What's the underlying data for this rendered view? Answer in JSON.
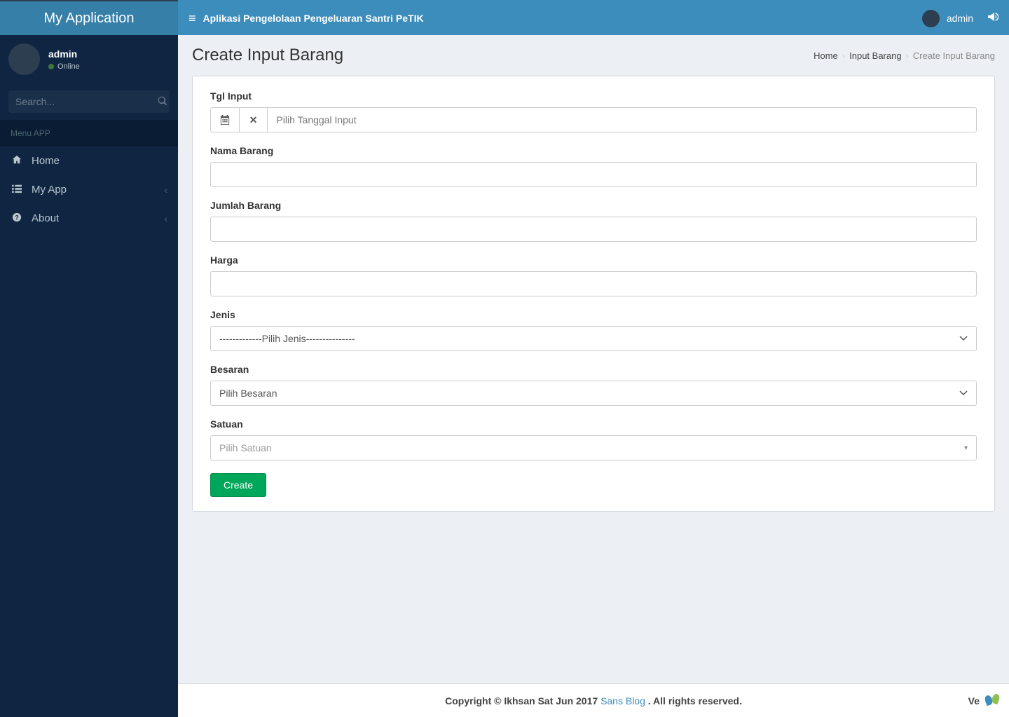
{
  "header": {
    "logo": "My Application",
    "app_title": "Aplikasi Pengelolaan Pengeluaran Santri PeTIK",
    "user_name": "admin"
  },
  "sidebar": {
    "user": {
      "name": "admin",
      "status": "Online"
    },
    "search_placeholder": "Search...",
    "menu_header": "Menu APP",
    "items": [
      {
        "label": "Home",
        "icon": "home-icon",
        "has_children": false
      },
      {
        "label": "My App",
        "icon": "list-icon",
        "has_children": true
      },
      {
        "label": "About",
        "icon": "question-icon",
        "has_children": true
      }
    ]
  },
  "page": {
    "title": "Create Input Barang",
    "breadcrumb": [
      {
        "label": "Home"
      },
      {
        "label": "Input Barang"
      },
      {
        "label": "Create Input Barang"
      }
    ]
  },
  "form": {
    "tgl_input": {
      "label": "Tgl Input",
      "placeholder": "Pilih Tanggal Input"
    },
    "nama_barang": {
      "label": "Nama Barang"
    },
    "jumlah_barang": {
      "label": "Jumlah Barang"
    },
    "harga": {
      "label": "Harga"
    },
    "jenis": {
      "label": "Jenis",
      "placeholder": "-------------Pilih Jenis---------------"
    },
    "besaran": {
      "label": "Besaran",
      "placeholder": "Pilih Besaran"
    },
    "satuan": {
      "label": "Satuan",
      "placeholder": "Pilih Satuan"
    },
    "submit_label": "Create"
  },
  "footer": {
    "copyright_prefix": "Copyright © Ikhsan Sat Jun 2017 ",
    "blog_link": "Sans Blog",
    "copyright_suffix": " . All rights reserved.",
    "right_prefix": "Ve"
  }
}
